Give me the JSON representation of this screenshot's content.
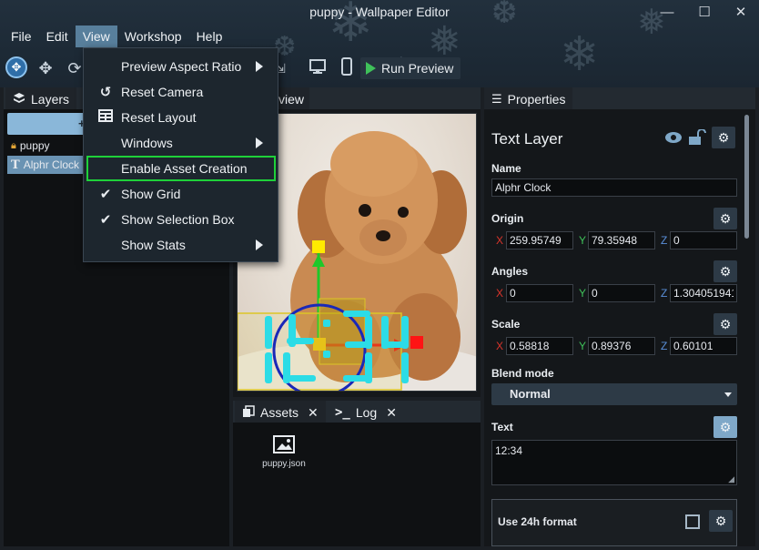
{
  "window": {
    "title": "puppy - Wallpaper Editor"
  },
  "menubar": {
    "items": [
      "File",
      "Edit",
      "View",
      "Workshop",
      "Help"
    ],
    "active": "View"
  },
  "toolbar": {
    "run_preview_label": "Run Preview"
  },
  "view_menu": {
    "items": [
      {
        "label": "Preview Aspect Ratio",
        "icon": "",
        "submenu": true
      },
      {
        "label": "Reset Camera",
        "icon": "reset-camera-icon",
        "submenu": false
      },
      {
        "label": "Reset Layout",
        "icon": "layout-grid-icon",
        "submenu": false
      },
      {
        "label": "Windows",
        "icon": "",
        "submenu": true
      },
      {
        "label": "Enable Asset Creation",
        "icon": "",
        "submenu": false,
        "highlighted": true
      },
      {
        "label": "Show Grid",
        "icon": "check-icon",
        "submenu": false
      },
      {
        "label": "Show Selection Box",
        "icon": "check-icon",
        "submenu": false
      },
      {
        "label": "Show Stats",
        "icon": "",
        "submenu": true
      }
    ]
  },
  "layers": {
    "tab_label": "Layers",
    "add_label": "+",
    "items": [
      {
        "label": "puppy",
        "icon": "lock-icon",
        "selected": false
      },
      {
        "label": "Alphr Clock",
        "icon": "text-layer-icon",
        "selected": true
      }
    ]
  },
  "preview": {
    "tab_label": "view",
    "clock_text": "12:34"
  },
  "assets": {
    "tabs": [
      "Assets",
      "Log"
    ],
    "files": [
      "puppy.json"
    ]
  },
  "properties": {
    "tab_label": "Properties",
    "header": "Text Layer",
    "name_label": "Name",
    "name_value": "Alphr Clock",
    "origin_label": "Origin",
    "origin": {
      "x": "259.95749",
      "y": "79.35948",
      "z": "0"
    },
    "angles_label": "Angles",
    "angles": {
      "x": "0",
      "y": "0",
      "z": "1.304051941"
    },
    "scale_label": "Scale",
    "scale": {
      "x": "0.58818",
      "y": "0.89376",
      "z": "0.60101"
    },
    "axis_x": "X",
    "axis_y": "Y",
    "axis_z": "Z",
    "blend_label": "Blend mode",
    "blend_value": "Normal",
    "text_label": "Text",
    "text_value": "12:34",
    "use24_label": "Use 24h format"
  },
  "colors": {
    "accent": "#587f9c",
    "highlight": "#1fd13a",
    "axis_x": "#d9342b",
    "axis_y": "#3fc15a",
    "axis_z": "#5a8fd8"
  }
}
